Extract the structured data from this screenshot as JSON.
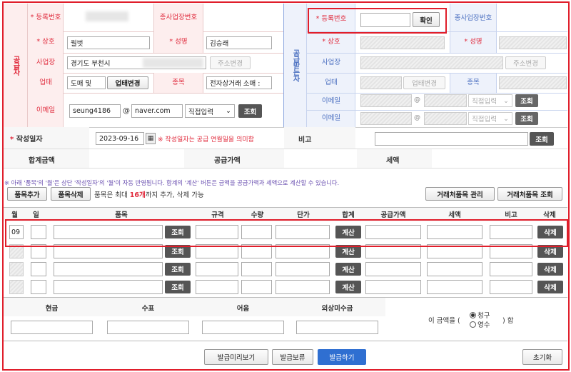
{
  "supplier": {
    "side_label": "공급자",
    "reg_no_label": "등록번호",
    "branch_no_label": "종사업장번호",
    "company_label": "상호",
    "company_value": "월벗",
    "name_label": "성명",
    "name_value": "김승래",
    "address_label": "사업장",
    "address_value": "경기도 부천시",
    "address_btn": "주소변경",
    "business_type_label": "업태",
    "business_type_value": "도매 및 ",
    "business_type_btn": "업태변경",
    "item_label": "종목",
    "item_value": "전자상거래 소매 :",
    "email_label": "이메일",
    "email_id": "seung4186",
    "email_domain": "naver.com",
    "email_select": "직접입력",
    "email_btn": "조회"
  },
  "receiver": {
    "side_label": "공급받는자",
    "reg_no_label": "등록번호",
    "confirm_btn": "확인",
    "branch_no_label": "종사업장번호",
    "company_label": "상호",
    "name_label": "성명",
    "address_label": "사업장",
    "address_btn": "주소변경",
    "business_type_label": "업태",
    "business_type_btn": "업태변경",
    "item_label": "종목",
    "email_label": "이메일",
    "email_at": "@",
    "email_select": "직접입력",
    "email_btn": "조회"
  },
  "date": {
    "label": "작성일자",
    "value": "2023-09-16",
    "note": "※ 작성일자는 공급 연월일을 의미함",
    "remark_label": "비고",
    "remark_btn": "조회"
  },
  "totals": {
    "total_label": "합계금액",
    "supply_label": "공급가액",
    "tax_label": "세액"
  },
  "notice": "※ 아래 '품목'의 '월'은 상단 '작성일자'의 '월'이 자동 반영됩니다. 합계의 '계산' 버튼은 금액을 공급가액과 세액으로 계산할 수 있습니다.",
  "items_toolbar": {
    "add_btn": "품목추가",
    "delete_btn": "품목삭제",
    "limit_prefix": "품목은 최대 ",
    "limit_count": "16개",
    "limit_suffix": "까지 추가, 삭제 가능",
    "manage_btn": "거래처품목 관리",
    "search_btn": "거래처품목 조회"
  },
  "item_headers": [
    "월",
    "일",
    "품목",
    "규격",
    "수량",
    "단가",
    "합계",
    "공급가액",
    "세액",
    "비고",
    "삭제"
  ],
  "item_rows": [
    {
      "month": "09",
      "lookup": "조회",
      "calc": "계산",
      "del": "삭제"
    },
    {
      "month": "",
      "lookup": "조회",
      "calc": "계산",
      "del": "삭제"
    },
    {
      "month": "",
      "lookup": "조회",
      "calc": "계산",
      "del": "삭제"
    },
    {
      "month": "",
      "lookup": "조회",
      "calc": "계산",
      "del": "삭제"
    }
  ],
  "payment": {
    "cash": "현금",
    "check": "수표",
    "note": "어음",
    "credit": "외상미수금",
    "amount_prefix": "이 금액을 (",
    "claim": "청구",
    "receipt": "영수",
    "amount_suffix": ") 함"
  },
  "footer": {
    "preview_btn": "발급미리보기",
    "hold_btn": "발급보류",
    "issue_btn": "발급하기",
    "reset_btn": "초기화"
  },
  "colors": {
    "accent": "#e0283a",
    "issue": "#2f6fd1"
  }
}
